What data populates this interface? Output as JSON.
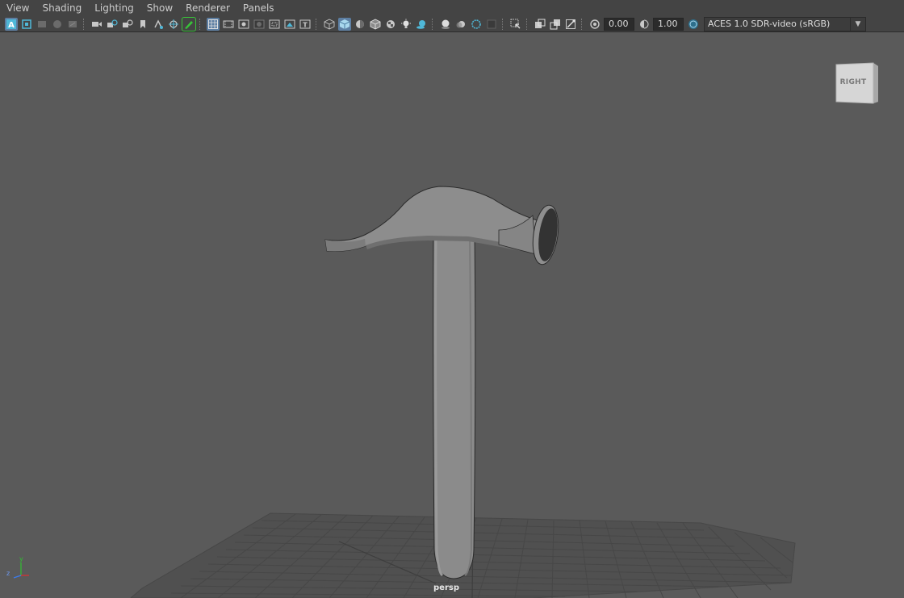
{
  "menubar": {
    "items": [
      {
        "label": "View"
      },
      {
        "label": "Shading"
      },
      {
        "label": "Lighting"
      },
      {
        "label": "Show"
      },
      {
        "label": "Renderer"
      },
      {
        "label": "Panels"
      }
    ]
  },
  "toolbar": {
    "exposure_value": "0.00",
    "gamma_value": "1.00",
    "color_space": "ACES 1.0 SDR-video (sRGB)",
    "colors": {
      "active": "#5d7fa3",
      "highlight": "#39c339",
      "icon": "#c8c8c8",
      "accent": "#4fb8d8"
    }
  },
  "viewport": {
    "viewcube_label": "RIGHT",
    "camera_label": "persp",
    "axis": {
      "x": "x",
      "y": "y",
      "z": "z"
    },
    "colors": {
      "background": "#5a5a5a",
      "grid": "#4a4a4a",
      "model": "#8a8a8a"
    }
  }
}
